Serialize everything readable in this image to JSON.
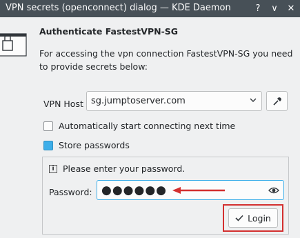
{
  "window": {
    "title": "VPN secrets (openconnect) dialog — KDE Daemon",
    "help_glyph": "?",
    "minimize_glyph": "∨",
    "close_glyph": "✕"
  },
  "dialog": {
    "heading": "Authenticate FastestVPN-SG",
    "description": "For accessing the vpn connection FastestVPN-SG you need to provide secrets below:"
  },
  "vpn_host": {
    "label": "VPN Host",
    "value": "sg.jumptoserver.com"
  },
  "options": {
    "auto_connect_label": "Automatically start connecting next time",
    "auto_connect_checked": false,
    "store_passwords_label": "Store passwords",
    "store_passwords_checked": true
  },
  "password_panel": {
    "info_text": "Please enter your password.",
    "password_label": "Password:",
    "password_mask": "●●●●●●"
  },
  "login_button": {
    "label": "Login"
  },
  "colors": {
    "titlebar": "#475057",
    "accent": "#3daee9",
    "annotation_red": "#d32f2f"
  }
}
